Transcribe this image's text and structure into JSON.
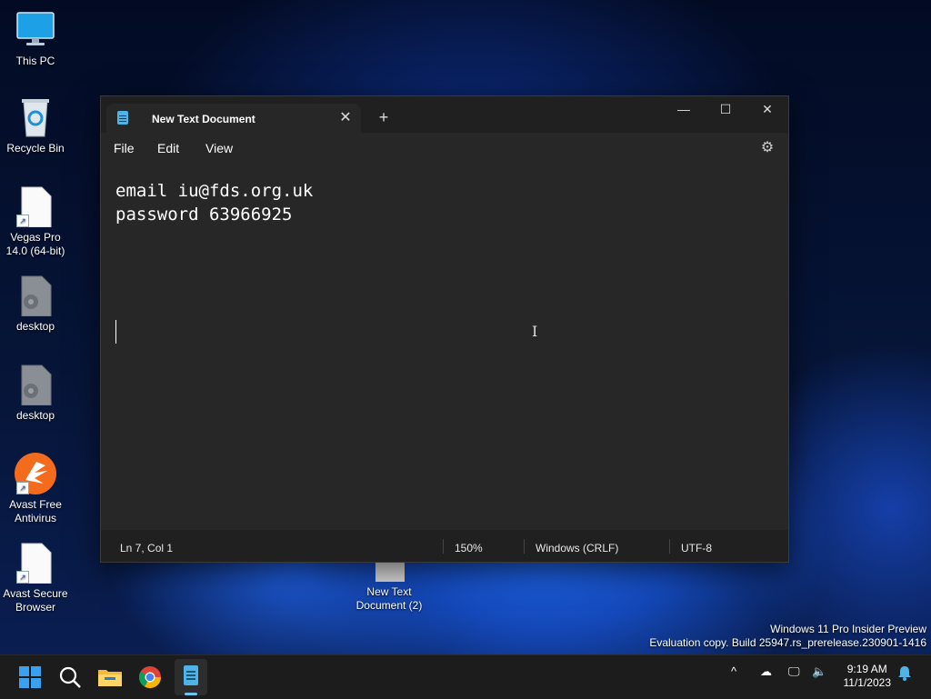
{
  "desktop": {
    "icons": [
      {
        "label": "This PC"
      },
      {
        "label": "Recycle Bin"
      },
      {
        "label": "Vegas Pro 14.0 (64-bit)"
      },
      {
        "label": "desktop"
      },
      {
        "label": "desktop"
      },
      {
        "label": "Avast Free Antivirus"
      },
      {
        "label": "Avast Secure Browser"
      },
      {
        "label": "New Text Document (2)"
      }
    ],
    "watermark_line1": "Windows 11 Pro Insider Preview",
    "watermark_line2": "Evaluation copy. Build 25947.rs_prerelease.230901-1416"
  },
  "notepad": {
    "tab_title": "New Text Document",
    "menu": {
      "file": "File",
      "edit": "Edit",
      "view": "View"
    },
    "content_lines": [
      "email iu@fds.org.uk",
      "password 63966925"
    ],
    "status": {
      "position": "Ln 7, Col 1",
      "zoom": "150%",
      "line_ending": "Windows (CRLF)",
      "encoding": "UTF-8"
    }
  },
  "taskbar": {
    "time": "9:19 AM",
    "date": "11/1/2023"
  }
}
